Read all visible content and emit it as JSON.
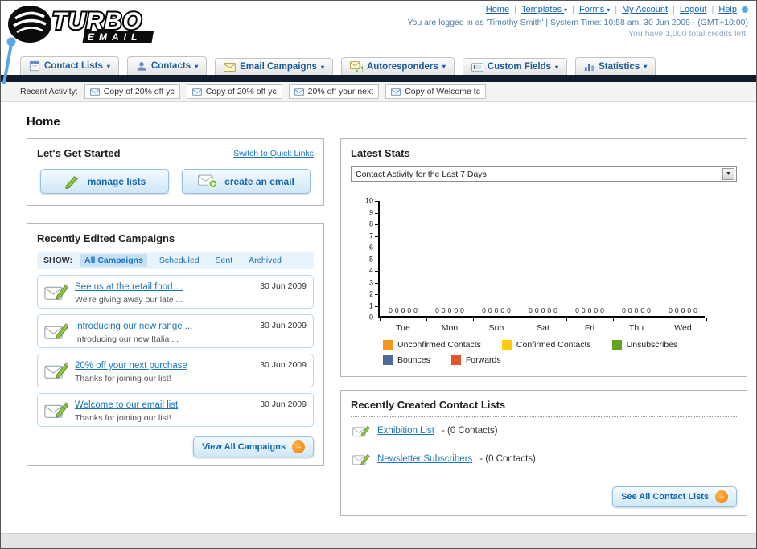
{
  "header": {
    "nav": [
      {
        "label": "Home",
        "caret": false
      },
      {
        "label": "Templates",
        "caret": true
      },
      {
        "label": "Forms",
        "caret": true
      },
      {
        "label": "My Account",
        "caret": false
      },
      {
        "label": "Logout",
        "caret": false
      },
      {
        "label": "Help",
        "caret": false
      }
    ],
    "login_info": "You are logged in as 'Timothy Smith' | System Time: 10:58 am, 30 Jun 2009 - (GMT+10:00)",
    "credits": "You have 1,000 total credits left.",
    "logo_text_main": "TURBO",
    "logo_text_sub": "EMAIL"
  },
  "main_nav": [
    {
      "label": "Contact Lists",
      "icon": "contact-lists-icon"
    },
    {
      "label": "Contacts",
      "icon": "contacts-icon"
    },
    {
      "label": "Email Campaigns",
      "icon": "email-campaigns-icon"
    },
    {
      "label": "Autoresponders",
      "icon": "autoresponders-icon"
    },
    {
      "label": "Custom Fields",
      "icon": "custom-fields-icon"
    },
    {
      "label": "Statistics",
      "icon": "statistics-icon"
    }
  ],
  "recent_activity": {
    "label": "Recent Activity:",
    "items": [
      "Copy of 20% off yc",
      "Copy of 20% off yc",
      "20% off your next",
      "Copy of Welcome tc"
    ]
  },
  "page_title": "Home",
  "get_started": {
    "title": "Let's Get Started",
    "switch_link": "Switch to Quick Links",
    "manage_lists": "manage lists",
    "create_email": "create an email"
  },
  "campaigns": {
    "title": "Recently Edited Campaigns",
    "show_label": "SHOW:",
    "filters": [
      "All Campaigns",
      "Scheduled",
      "Sent",
      "Archived"
    ],
    "active_filter": "All Campaigns",
    "items": [
      {
        "title": "See us at the retail food ...",
        "subtitle": "We're giving away our late ...",
        "date": "30 Jun 2009"
      },
      {
        "title": "Introducing our new range ...",
        "subtitle": "Introducing our new Italia ...",
        "date": "30 Jun 2009"
      },
      {
        "title": "20% off your next purchase",
        "subtitle": "Thanks for joining our list!",
        "date": "30 Jun 2009"
      },
      {
        "title": "Welcome to our email list",
        "subtitle": "Thanks for joining our list!",
        "date": "30 Jun 2009"
      }
    ],
    "view_all_label": "View All Campaigns"
  },
  "stats": {
    "title": "Latest Stats",
    "selected_option": "Contact Activity for the Last 7 Days"
  },
  "chart_data": {
    "type": "bar",
    "title": "Contact Activity for the Last 7 Days",
    "categories": [
      "Tue",
      "Mon",
      "Sun",
      "Sat",
      "Fri",
      "Thu",
      "Wed"
    ],
    "series": [
      {
        "name": "Unconfirmed Contacts",
        "color": "#f7941d",
        "values": [
          0,
          0,
          0,
          0,
          0,
          0,
          0
        ]
      },
      {
        "name": "Confirmed Contacts",
        "color": "#ffcc00",
        "values": [
          0,
          0,
          0,
          0,
          0,
          0,
          0
        ]
      },
      {
        "name": "Unsubscribes",
        "color": "#62a420",
        "values": [
          0,
          0,
          0,
          0,
          0,
          0,
          0
        ]
      },
      {
        "name": "Bounces",
        "color": "#50699b",
        "values": [
          0,
          0,
          0,
          0,
          0,
          0,
          0
        ]
      },
      {
        "name": "Forwards",
        "color": "#e2542b",
        "values": [
          0,
          0,
          0,
          0,
          0,
          0,
          0
        ]
      }
    ],
    "ylim": [
      0,
      10
    ],
    "yticks": [
      10,
      9,
      8,
      7,
      6,
      5,
      4,
      3,
      2,
      1,
      0
    ],
    "grid": false,
    "legend_position": "bottom"
  },
  "contact_lists": {
    "title": "Recently Created Contact Lists",
    "items": [
      {
        "name": "Exhibition List",
        "meta": "- (0 Contacts)"
      },
      {
        "name": "Newsletter Subscribers",
        "meta": "- (0 Contacts)"
      }
    ],
    "see_all_label": "See All Contact Lists"
  }
}
